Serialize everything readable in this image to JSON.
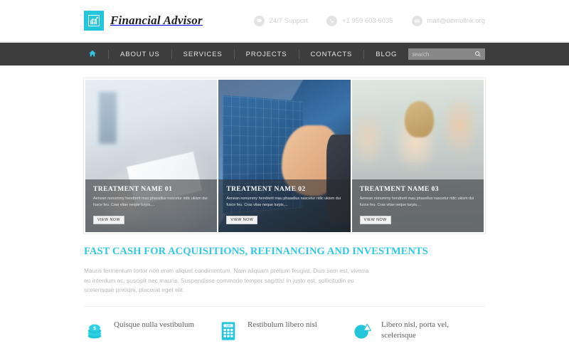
{
  "header": {
    "logo": {
      "text": "Financial Advisor",
      "icon": "bar-chart-growth-icon",
      "accent": "#24c6dc"
    },
    "contacts": [
      {
        "icon": "chat-bubble-icon",
        "text": "24/7 Support"
      },
      {
        "icon": "phone-icon",
        "text": "+1 959 603 6035"
      },
      {
        "icon": "envelope-icon",
        "text": "mail@demolink.org"
      }
    ]
  },
  "nav": {
    "home_icon": "home-icon",
    "items": [
      {
        "label": "ABOUT US"
      },
      {
        "label": "SERVICES"
      },
      {
        "label": "PROJECTS"
      },
      {
        "label": "CONTACTS"
      },
      {
        "label": "BLOG"
      }
    ],
    "search": {
      "placeholder": "search",
      "value": "",
      "icon": "search-icon"
    }
  },
  "slider": {
    "slides": [
      {
        "title": "TREATMENT NAME 01",
        "text": "Aenean nonummy hendrerit mau phasellus nascetur ridic ukism dui fusce feu. Cras vitae neque turpis,...",
        "button": "VIEW NOW",
        "image": "hands-with-documents-and-pen"
      },
      {
        "title": "TREATMENT NAME 02",
        "text": "Aenean nonummy hendrerit mau phasellus nascetur ridic ukism dui fusce feu. Cras vitae neque turpis,...",
        "button": "VIEW NOW",
        "image": "hand-touching-blue-chart-screen"
      },
      {
        "title": "TREATMENT NAME 03",
        "text": "Aenean nonummy hendrerit mau phasellus nascetur ridic ukism dui fusce feu. Cras vitae neque turpis,...",
        "button": "VIEW NOW",
        "image": "business-team-portrait"
      }
    ]
  },
  "main": {
    "headline": "FAST CASH FOR ACQUISITIONS, REFINANCING AND INVESTMENTS",
    "headline_color": "#2ec9e4",
    "paragraph": "Mauris fermentum tortor non enim aliquet condimentum. Nam aliquam pretium feugiat. Duis sem est, viverra eu interdum ac, suscipit nec mauris. Suspendisse commodo tempor sagittis! In justo est, sollicitudin eu scelerisque pretium, placerat eget elit."
  },
  "features": [
    {
      "icon": "coins-stack-icon",
      "label": "Quisque nulla vestibulum"
    },
    {
      "icon": "calculator-icon",
      "label": "Restibulum libero nisl"
    },
    {
      "icon": "pie-chart-icon",
      "label": "Libero nisl, porta vel, scelerisque"
    }
  ],
  "theme": {
    "accent": "#24c6dc",
    "nav_bg": "#3d3d3d",
    "text_muted": "#b9b9b9"
  }
}
